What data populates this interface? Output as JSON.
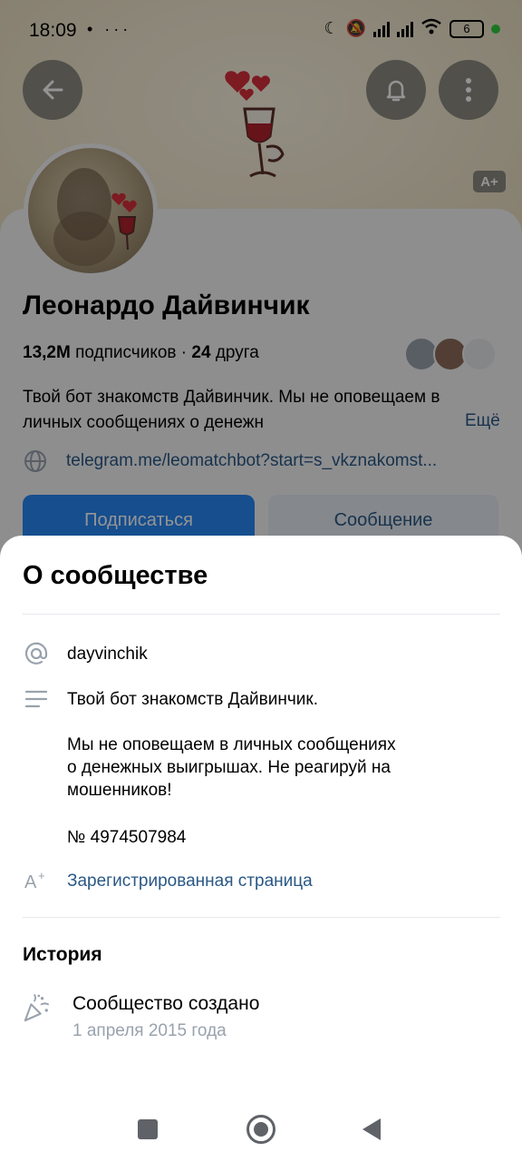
{
  "status_bar": {
    "time": "18:09",
    "left_icons": "• ···",
    "battery": "6"
  },
  "header": {
    "back_icon": "arrow-left-icon",
    "bell_icon": "bell-icon",
    "more_icon": "more-vertical-icon",
    "badge": "A+"
  },
  "profile": {
    "name": "Леонардо Дайвинчик",
    "subscribers_count": "13,2M",
    "subscribers_label": "подписчиков",
    "separator": "·",
    "friends_count": "24",
    "friends_label": "друга",
    "description": "Твой бот знакомств Дайвинчик. Мы не оповещаем в личных сообщениях о денежн",
    "more_label": "Ещё",
    "link": "telegram.me/leomatchbot?start=s_vkznakomst...",
    "subscribe_button": "Подписаться",
    "message_button": "Сообщение"
  },
  "about_sheet": {
    "title": "О сообществе",
    "handle": "dayvinchik",
    "description_line1": "Твой бот знакомств Дайвинчик.",
    "description_para2_line1": "Мы не оповещаем в личных сообщениях",
    "description_para2_line2": "о денежных выигрышах. Не реагируй на",
    "description_para2_line3": "мошенников!",
    "number": "№ 4974507984",
    "registered": "Зарегистрированная страница",
    "history_title": "История",
    "event_title": "Сообщество создано",
    "event_date": "1 апреля 2015 года"
  },
  "colors": {
    "accent": "#2787f5",
    "link": "#2a5885",
    "secondary_text": "#99a2ad"
  }
}
